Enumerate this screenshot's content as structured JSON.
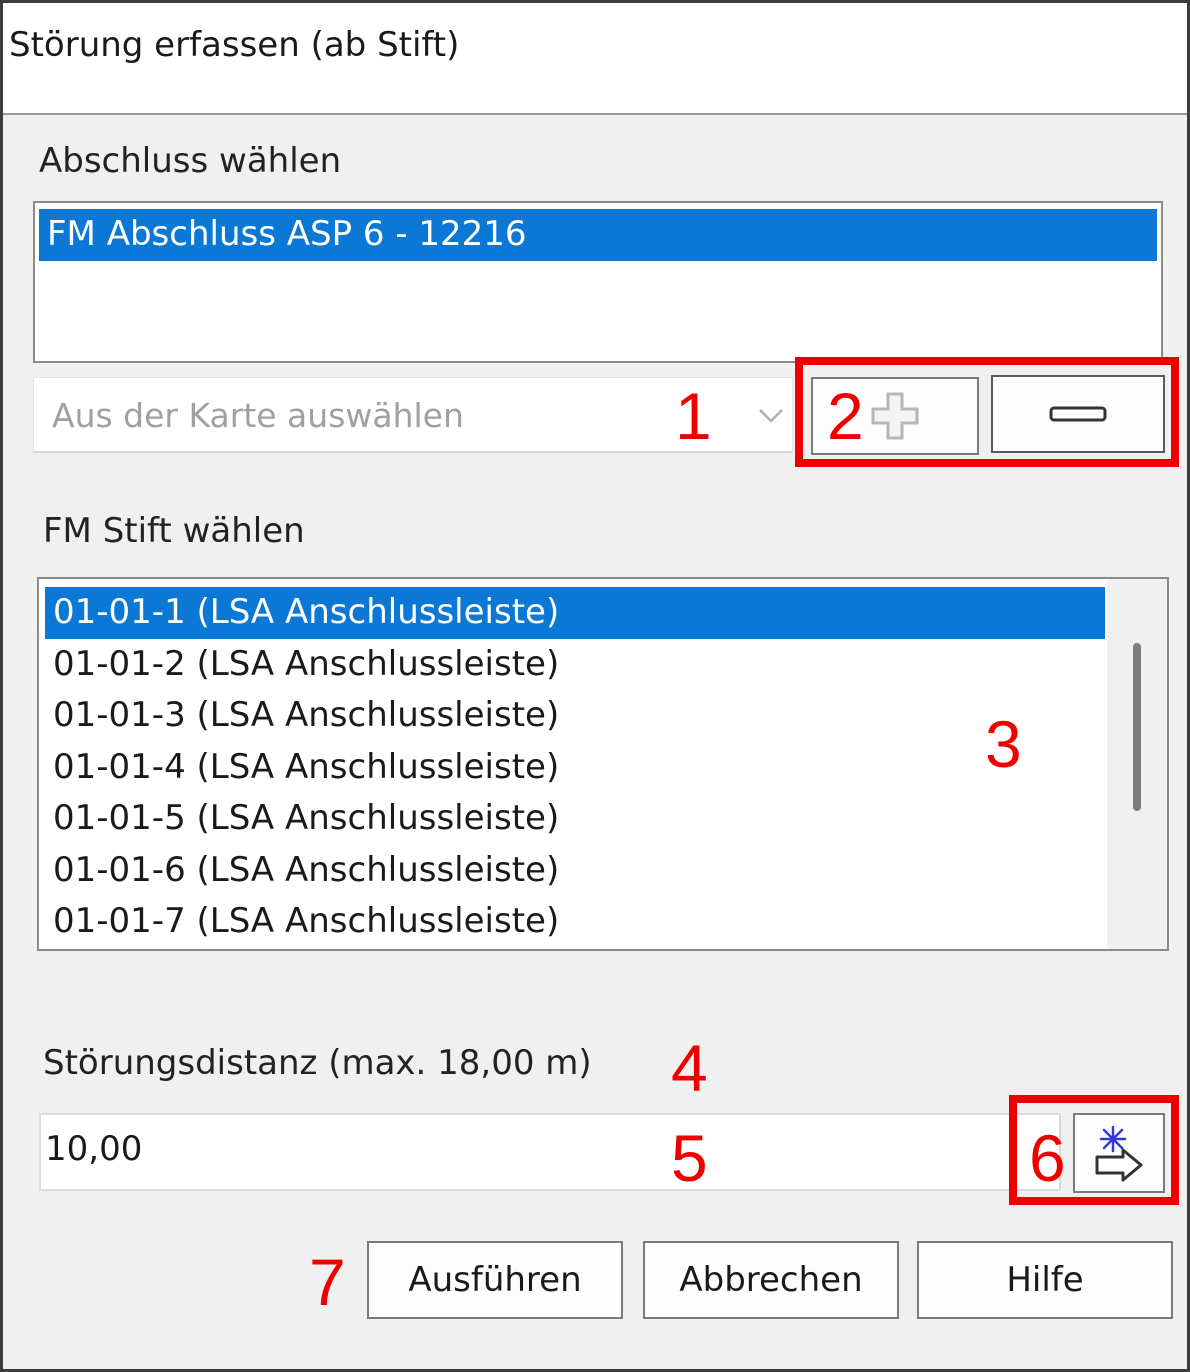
{
  "dialog": {
    "title": "Störung erfassen (ab Stift)"
  },
  "abschluss": {
    "label": "Abschluss wählen",
    "items": [
      {
        "label": "FM Abschluss ASP 6 - 12216",
        "selected": true
      }
    ],
    "combo_placeholder": "Aus der Karte auswählen",
    "add_icon": "plus-icon",
    "remove_icon": "minus-icon"
  },
  "stift": {
    "label": "FM Stift wählen",
    "items": [
      {
        "label": "01-01-1 (LSA Anschlussleiste)",
        "selected": true
      },
      {
        "label": "01-01-2 (LSA Anschlussleiste)",
        "selected": false
      },
      {
        "label": "01-01-3 (LSA Anschlussleiste)",
        "selected": false
      },
      {
        "label": "01-01-4 (LSA Anschlussleiste)",
        "selected": false
      },
      {
        "label": "01-01-5 (LSA Anschlussleiste)",
        "selected": false
      },
      {
        "label": "01-01-6 (LSA Anschlussleiste)",
        "selected": false
      },
      {
        "label": "01-01-7 (LSA Anschlussleiste)",
        "selected": false
      }
    ]
  },
  "distance": {
    "label": "Störungsdistanz (max. 18,00 m)",
    "value": "10,00",
    "pick_icon": "pick-point-arrow-icon"
  },
  "buttons": {
    "execute": "Ausführen",
    "cancel": "Abbrechen",
    "help": "Hilfe"
  },
  "annotations": [
    "1",
    "2",
    "3",
    "4",
    "5",
    "6",
    "7"
  ],
  "colors": {
    "selection": "#0a78d4",
    "annotation": "#ee0000"
  }
}
